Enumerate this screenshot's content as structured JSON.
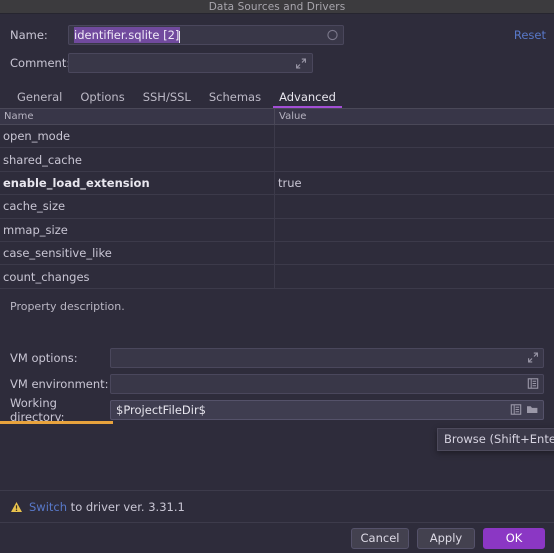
{
  "window": {
    "title": "Data Sources and Drivers"
  },
  "form": {
    "name_label": "Name:",
    "name_value": "identifier.sqlite [2]",
    "name_icon": "circle-progress-icon",
    "comment_label": "Comment:",
    "comment_value": "",
    "comment_placeholder": "",
    "comment_icon": "expand-icon",
    "reset_label": "Reset"
  },
  "tabs": [
    {
      "label": "General",
      "active": false
    },
    {
      "label": "Options",
      "active": false
    },
    {
      "label": "SSH/SSL",
      "active": false
    },
    {
      "label": "Schemas",
      "active": false
    },
    {
      "label": "Advanced",
      "active": true
    }
  ],
  "table": {
    "columns": [
      "Name",
      "Value"
    ],
    "rows": [
      {
        "name": "open_mode",
        "value": "",
        "bold": false
      },
      {
        "name": "shared_cache",
        "value": "",
        "bold": false
      },
      {
        "name": "enable_load_extension",
        "value": "true",
        "bold": true
      },
      {
        "name": "cache_size",
        "value": "",
        "bold": false
      },
      {
        "name": "mmap_size",
        "value": "",
        "bold": false
      },
      {
        "name": "case_sensitive_like",
        "value": "",
        "bold": false
      },
      {
        "name": "count_changes",
        "value": "",
        "bold": false
      }
    ]
  },
  "property_description": "Property description.",
  "vm": {
    "options_label": "VM options:",
    "options_value": "",
    "options_icon": "expand-icon",
    "environment_label": "VM environment:",
    "environment_value": "",
    "environment_icon": "variables-list-icon",
    "working_directory_label": "Working directory:",
    "working_directory_value": "$ProjectFileDir$",
    "working_directory_icon_1": "variables-list-icon",
    "working_directory_icon_2": "folder-icon"
  },
  "tooltip": {
    "text": "Browse (Shift+Enter)"
  },
  "warning": {
    "icon": "warning-triangle-icon",
    "link_label": "Switch",
    "text_after": " to driver ver. 3.31.1"
  },
  "buttons": {
    "cancel": "Cancel",
    "apply": "Apply",
    "ok": "OK"
  },
  "colors": {
    "accent_purple": "#a34fd6",
    "ok_button": "#8b37c4",
    "link_blue": "#5878c8",
    "warning_yellow": "#e8c24d",
    "focus_orange": "#e8a33d",
    "selection_purple": "#714a9e",
    "background": "#2e2c3b",
    "titlebar": "#3c3b3e"
  }
}
